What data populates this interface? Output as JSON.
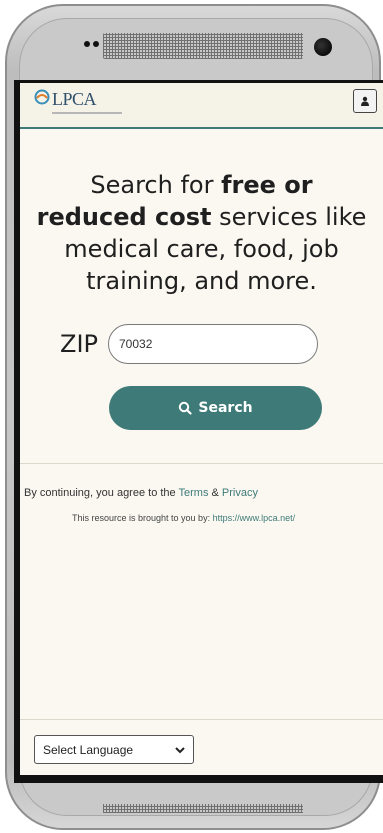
{
  "header": {
    "logo_text": "LPCA",
    "user_icon": "user-icon"
  },
  "hero": {
    "part1": "Search for ",
    "bold": "free or reduced cost",
    "part2": " services like medical care, food, job training, and more."
  },
  "search": {
    "zip_label": "ZIP",
    "zip_value": "70032",
    "button_label": "Search",
    "button_icon": "search-icon"
  },
  "footer": {
    "agree_prefix": "By continuing, you agree to the ",
    "terms": "Terms",
    "amp": " & ",
    "privacy": "Privacy",
    "credit_prefix": "This resource is brought to you by: ",
    "credit_link": "https://www.lpca.net/"
  },
  "language": {
    "selected": "Select Language"
  },
  "colors": {
    "brand": "#3e7a78",
    "background": "#faf8f1"
  }
}
